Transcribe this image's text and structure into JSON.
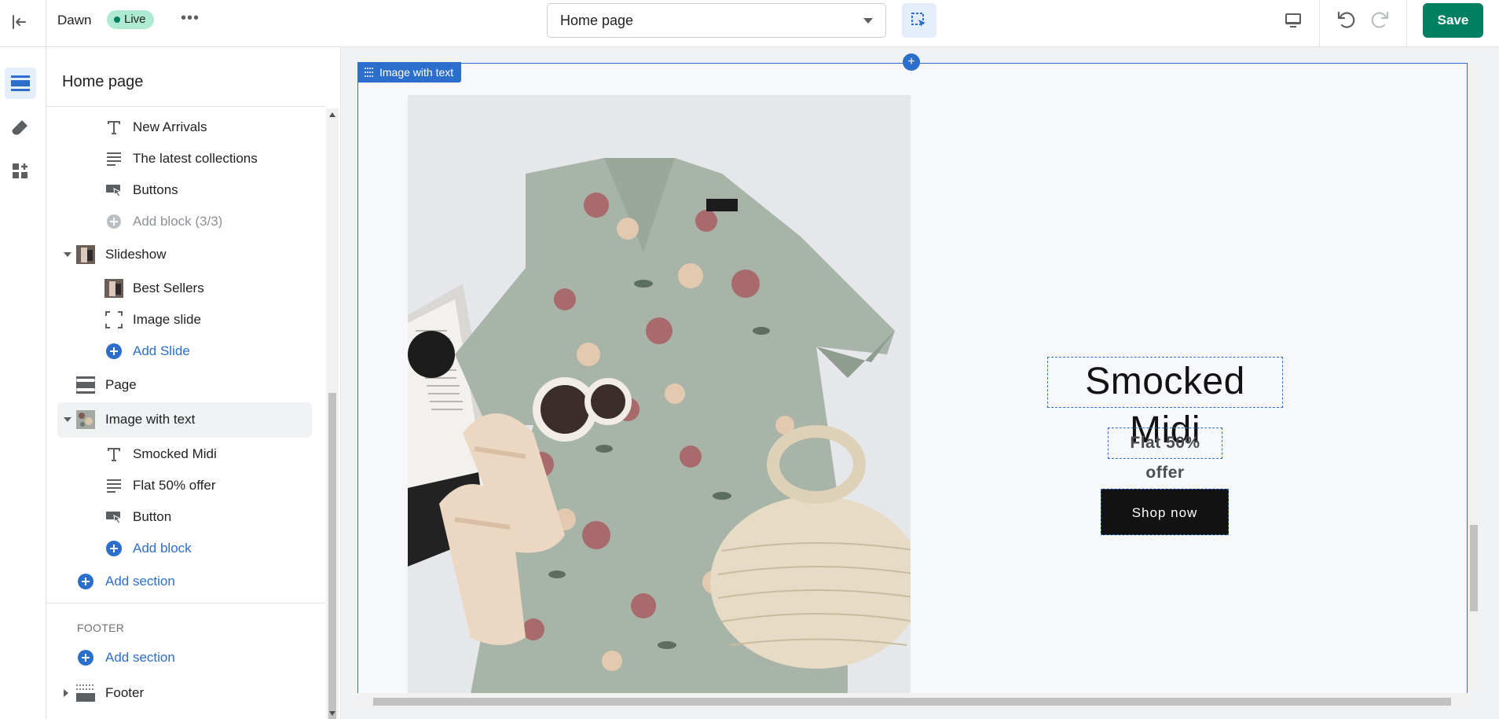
{
  "topbar": {
    "theme_name": "Dawn",
    "status_badge": "Live",
    "more_label": "•••",
    "page_select": "Home page",
    "save_label": "Save"
  },
  "rail": {
    "items": [
      {
        "name": "sections",
        "icon": "sections-icon",
        "active": true
      },
      {
        "name": "theme-settings",
        "icon": "paintbrush-icon",
        "active": false
      },
      {
        "name": "app-embeds",
        "icon": "apps-icon",
        "active": false
      }
    ]
  },
  "panel": {
    "title": "Home page",
    "items": [
      {
        "label": "New Arrivals",
        "icon": "text-icon"
      },
      {
        "label": "The latest collections",
        "icon": "paragraph-icon"
      },
      {
        "label": "Buttons",
        "icon": "button-icon"
      },
      {
        "label": "Add block (3/3)",
        "icon": "add-circle-icon"
      },
      {
        "label": "Slideshow",
        "icon": "slideshow-thumb-icon"
      },
      {
        "label": "Best Sellers",
        "icon": "image-thumb-icon"
      },
      {
        "label": "Image slide",
        "icon": "image-placeholder-icon"
      },
      {
        "label": "Add Slide",
        "icon": "add-circle-icon"
      },
      {
        "label": "Page",
        "icon": "page-section-icon"
      },
      {
        "label": "Image with text",
        "icon": "image-with-text-thumb-icon"
      },
      {
        "label": "Smocked Midi",
        "icon": "text-icon"
      },
      {
        "label": "Flat 50% offer",
        "icon": "paragraph-icon"
      },
      {
        "label": "Button",
        "icon": "button-icon"
      },
      {
        "label": "Add block",
        "icon": "add-circle-icon"
      },
      {
        "label": "Add section",
        "icon": "add-circle-icon"
      }
    ],
    "footer_group": "FOOTER",
    "footer_add": "Add section",
    "footer_item": "Footer"
  },
  "preview": {
    "section_tag": "Image with text",
    "headline": "Smocked Midi",
    "subtext": "Flat 50% offer",
    "button": "Shop now"
  },
  "colors": {
    "accent": "#2c6ecb",
    "save": "#008060",
    "live_badge": "#aee9d1"
  }
}
